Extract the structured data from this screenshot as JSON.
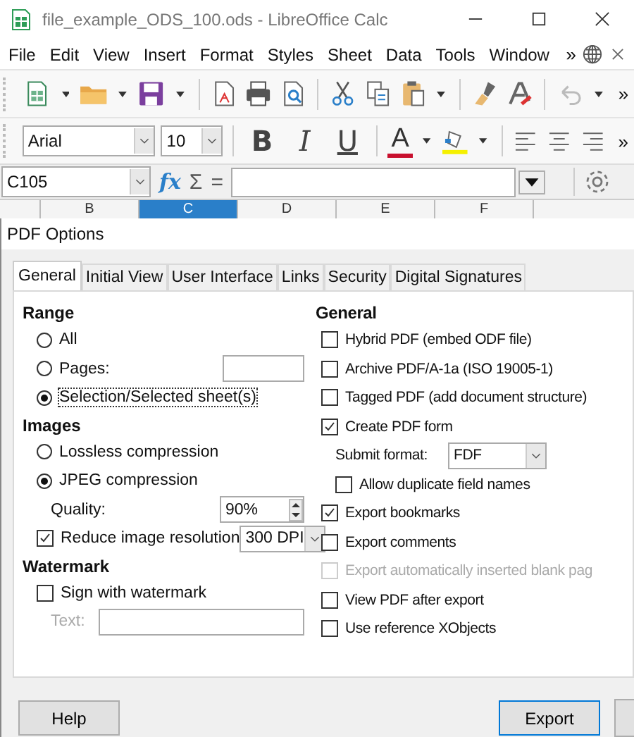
{
  "window": {
    "title": "file_example_ODS_100.ods - LibreOffice Calc"
  },
  "menu": [
    "File",
    "Edit",
    "View",
    "Insert",
    "Format",
    "Styles",
    "Sheet",
    "Data",
    "Tools",
    "Window"
  ],
  "menu_overflow": "»",
  "toolbar_overflow": "»",
  "format_bar": {
    "font": "Arial",
    "size": "10",
    "styles": [
      "B",
      "I",
      "U"
    ],
    "font_color_letter": "A",
    "overflow": "»"
  },
  "formula_bar": {
    "name_box": "C105",
    "symbols": [
      "fx",
      "Σ",
      "="
    ]
  },
  "columns": [
    {
      "label": "B",
      "selected": false
    },
    {
      "label": "C",
      "selected": true
    },
    {
      "label": "D",
      "selected": false
    },
    {
      "label": "E",
      "selected": false
    },
    {
      "label": "F",
      "selected": false
    }
  ],
  "dialog": {
    "title": "PDF Options",
    "tabs": [
      {
        "label": "General",
        "selected": true
      },
      {
        "label": "Initial View",
        "selected": false
      },
      {
        "label": "User Interface",
        "selected": false
      },
      {
        "label": "Links",
        "selected": false
      },
      {
        "label": "Security",
        "selected": false
      },
      {
        "label": "Digital Signatures",
        "selected": false
      }
    ],
    "range": {
      "heading": "Range",
      "options": [
        {
          "label": "All",
          "selected": false
        },
        {
          "label": "Pages:",
          "selected": false
        },
        {
          "label": "Selection/Selected sheet(s)",
          "selected": true
        }
      ]
    },
    "images": {
      "heading": "Images",
      "options": [
        {
          "label": "Lossless compression",
          "selected": false
        },
        {
          "label": "JPEG compression",
          "selected": true
        }
      ],
      "quality_label": "Quality:",
      "quality": "90%",
      "reduce_label": "Reduce image resolution",
      "reduce_checked": true,
      "resolution": "300 DPI"
    },
    "watermark": {
      "heading": "Watermark",
      "sign_label": "Sign with watermark",
      "sign_checked": false,
      "text_label": "Text:"
    },
    "general": {
      "heading": "General",
      "items": [
        {
          "kind": "checkbox",
          "label": "Hybrid PDF (embed ODF file)",
          "checked": false,
          "disabled": false
        },
        {
          "kind": "checkbox",
          "label": "Archive PDF/A-1a (ISO 19005-1)",
          "checked": false,
          "disabled": false
        },
        {
          "kind": "checkbox",
          "label": "Tagged PDF (add document structure)",
          "checked": false,
          "disabled": false
        },
        {
          "kind": "checkbox",
          "label": "Create PDF form",
          "checked": true,
          "disabled": false,
          "children": [
            {
              "kind": "select",
              "label": "Submit format:",
              "value": "FDF"
            },
            {
              "kind": "checkbox",
              "label": "Allow duplicate field names",
              "checked": false,
              "disabled": false
            }
          ]
        },
        {
          "kind": "checkbox",
          "label": "Export bookmarks",
          "checked": true,
          "disabled": false
        },
        {
          "kind": "checkbox",
          "label": "Export comments",
          "checked": false,
          "disabled": false
        },
        {
          "kind": "checkbox",
          "label": "Export automatically inserted blank pag",
          "checked": false,
          "disabled": true
        },
        {
          "kind": "checkbox",
          "label": "View PDF after export",
          "checked": false,
          "disabled": false
        },
        {
          "kind": "checkbox",
          "label": "Use reference XObjects",
          "checked": false,
          "disabled": false
        }
      ]
    },
    "buttons": [
      {
        "label": "Help",
        "kind": "plain"
      },
      {
        "label": "Export",
        "kind": "default"
      }
    ]
  }
}
